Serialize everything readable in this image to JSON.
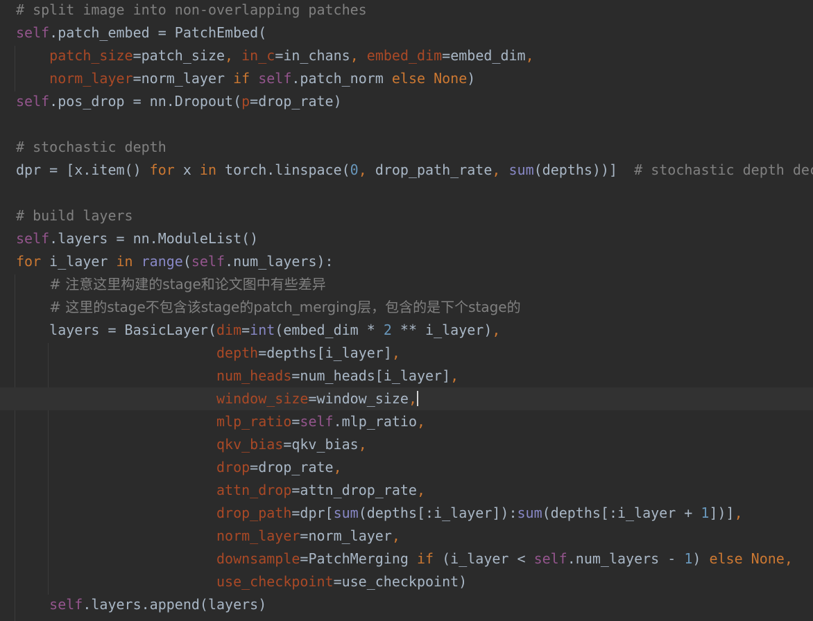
{
  "editor": {
    "theme": "dark",
    "colors": {
      "background": "#2b2b2b",
      "current_line": "#323232",
      "comment": "#808080",
      "keyword": "#cc7832",
      "self": "#94558d",
      "param": "#aa4926",
      "number": "#6897bb",
      "builtin": "#8888c6",
      "text": "#a9b7c6"
    },
    "current_line_index": 17,
    "lines": [
      {
        "indent": "",
        "tokens": [
          {
            "t": "comment",
            "v": "# split image into non-overlapping patches"
          }
        ]
      },
      {
        "indent": "",
        "tokens": [
          {
            "t": "self",
            "v": "self"
          },
          {
            "t": "plain",
            "v": ".patch_embed = PatchEmbed("
          }
        ]
      },
      {
        "indent": "    ",
        "tokens": [
          {
            "t": "param",
            "v": "patch_size"
          },
          {
            "t": "plain",
            "v": "=patch_size"
          },
          {
            "t": "keyword",
            "v": ", "
          },
          {
            "t": "param",
            "v": "in_c"
          },
          {
            "t": "plain",
            "v": "=in_chans"
          },
          {
            "t": "keyword",
            "v": ", "
          },
          {
            "t": "param",
            "v": "embed_dim"
          },
          {
            "t": "plain",
            "v": "=embed_dim"
          },
          {
            "t": "keyword",
            "v": ","
          }
        ]
      },
      {
        "indent": "    ",
        "tokens": [
          {
            "t": "param",
            "v": "norm_layer"
          },
          {
            "t": "plain",
            "v": "=norm_layer "
          },
          {
            "t": "keyword",
            "v": "if "
          },
          {
            "t": "self",
            "v": "self"
          },
          {
            "t": "plain",
            "v": ".patch_norm "
          },
          {
            "t": "keyword",
            "v": "else None"
          },
          {
            "t": "plain",
            "v": ")"
          }
        ]
      },
      {
        "indent": "",
        "tokens": [
          {
            "t": "self",
            "v": "self"
          },
          {
            "t": "plain",
            "v": ".pos_drop = nn.Dropout("
          },
          {
            "t": "param",
            "v": "p"
          },
          {
            "t": "plain",
            "v": "=drop_rate)"
          }
        ]
      },
      {
        "indent": "",
        "tokens": []
      },
      {
        "indent": "",
        "tokens": [
          {
            "t": "comment",
            "v": "# stochastic depth"
          }
        ]
      },
      {
        "indent": "",
        "tokens": [
          {
            "t": "plain",
            "v": "dpr = [x.item() "
          },
          {
            "t": "keyword",
            "v": "for "
          },
          {
            "t": "plain",
            "v": "x "
          },
          {
            "t": "keyword",
            "v": "in "
          },
          {
            "t": "plain",
            "v": "torch.linspace("
          },
          {
            "t": "number",
            "v": "0"
          },
          {
            "t": "keyword",
            "v": ", "
          },
          {
            "t": "plain",
            "v": "drop_path_rate"
          },
          {
            "t": "keyword",
            "v": ", "
          },
          {
            "t": "builtin",
            "v": "sum"
          },
          {
            "t": "plain",
            "v": "(depths))]  "
          },
          {
            "t": "comment",
            "v": "# stochastic depth dec"
          }
        ]
      },
      {
        "indent": "",
        "tokens": []
      },
      {
        "indent": "",
        "tokens": [
          {
            "t": "comment",
            "v": "# build layers"
          }
        ]
      },
      {
        "indent": "",
        "tokens": [
          {
            "t": "self",
            "v": "self"
          },
          {
            "t": "plain",
            "v": ".layers = nn.ModuleList()"
          }
        ]
      },
      {
        "indent": "",
        "tokens": [
          {
            "t": "keyword",
            "v": "for "
          },
          {
            "t": "plain",
            "v": "i_layer "
          },
          {
            "t": "keyword",
            "v": "in "
          },
          {
            "t": "builtin",
            "v": "range"
          },
          {
            "t": "plain",
            "v": "("
          },
          {
            "t": "self",
            "v": "self"
          },
          {
            "t": "plain",
            "v": ".num_layers):"
          }
        ]
      },
      {
        "indent": "    ",
        "tokens": [
          {
            "t": "comment",
            "v": "# 注意这里构建的stage和论文图中有些差异"
          }
        ]
      },
      {
        "indent": "    ",
        "tokens": [
          {
            "t": "comment",
            "v": "# 这里的stage不包含该stage的patch_merging层，包含的是下个stage的"
          }
        ]
      },
      {
        "indent": "    ",
        "tokens": [
          {
            "t": "plain",
            "v": "layers = BasicLayer("
          },
          {
            "t": "param",
            "v": "dim"
          },
          {
            "t": "plain",
            "v": "="
          },
          {
            "t": "builtin",
            "v": "int"
          },
          {
            "t": "plain",
            "v": "(embed_dim * "
          },
          {
            "t": "number",
            "v": "2"
          },
          {
            "t": "plain",
            "v": " ** i_layer)"
          },
          {
            "t": "keyword",
            "v": ","
          }
        ]
      },
      {
        "indent": "                        ",
        "tokens": [
          {
            "t": "param",
            "v": "depth"
          },
          {
            "t": "plain",
            "v": "=depths[i_layer]"
          },
          {
            "t": "keyword",
            "v": ","
          }
        ]
      },
      {
        "indent": "                        ",
        "tokens": [
          {
            "t": "param",
            "v": "num_heads"
          },
          {
            "t": "plain",
            "v": "=num_heads[i_layer]"
          },
          {
            "t": "keyword",
            "v": ","
          }
        ]
      },
      {
        "indent": "                        ",
        "tokens": [
          {
            "t": "param",
            "v": "window_size"
          },
          {
            "t": "plain",
            "v": "=window_size"
          },
          {
            "t": "keyword",
            "v": ","
          }
        ],
        "caret": true
      },
      {
        "indent": "                        ",
        "tokens": [
          {
            "t": "param",
            "v": "mlp_ratio"
          },
          {
            "t": "plain",
            "v": "="
          },
          {
            "t": "self",
            "v": "self"
          },
          {
            "t": "plain",
            "v": ".mlp_ratio"
          },
          {
            "t": "keyword",
            "v": ","
          }
        ]
      },
      {
        "indent": "                        ",
        "tokens": [
          {
            "t": "param",
            "v": "qkv_bias"
          },
          {
            "t": "plain",
            "v": "=qkv_bias"
          },
          {
            "t": "keyword",
            "v": ","
          }
        ]
      },
      {
        "indent": "                        ",
        "tokens": [
          {
            "t": "param",
            "v": "drop"
          },
          {
            "t": "plain",
            "v": "=drop_rate"
          },
          {
            "t": "keyword",
            "v": ","
          }
        ]
      },
      {
        "indent": "                        ",
        "tokens": [
          {
            "t": "param",
            "v": "attn_drop"
          },
          {
            "t": "plain",
            "v": "=attn_drop_rate"
          },
          {
            "t": "keyword",
            "v": ","
          }
        ]
      },
      {
        "indent": "                        ",
        "tokens": [
          {
            "t": "param",
            "v": "drop_path"
          },
          {
            "t": "plain",
            "v": "=dpr["
          },
          {
            "t": "builtin",
            "v": "sum"
          },
          {
            "t": "plain",
            "v": "(depths[:i_layer]):"
          },
          {
            "t": "builtin",
            "v": "sum"
          },
          {
            "t": "plain",
            "v": "(depths[:i_layer + "
          },
          {
            "t": "number",
            "v": "1"
          },
          {
            "t": "plain",
            "v": "])]"
          },
          {
            "t": "keyword",
            "v": ","
          }
        ]
      },
      {
        "indent": "                        ",
        "tokens": [
          {
            "t": "param",
            "v": "norm_layer"
          },
          {
            "t": "plain",
            "v": "=norm_layer"
          },
          {
            "t": "keyword",
            "v": ","
          }
        ]
      },
      {
        "indent": "                        ",
        "tokens": [
          {
            "t": "param",
            "v": "downsample"
          },
          {
            "t": "plain",
            "v": "=PatchMerging "
          },
          {
            "t": "keyword",
            "v": "if "
          },
          {
            "t": "plain",
            "v": "(i_layer < "
          },
          {
            "t": "self",
            "v": "self"
          },
          {
            "t": "plain",
            "v": ".num_layers - "
          },
          {
            "t": "number",
            "v": "1"
          },
          {
            "t": "plain",
            "v": ") "
          },
          {
            "t": "keyword",
            "v": "else None,"
          }
        ]
      },
      {
        "indent": "                        ",
        "tokens": [
          {
            "t": "param",
            "v": "use_checkpoint"
          },
          {
            "t": "plain",
            "v": "=use_checkpoint)"
          }
        ]
      },
      {
        "indent": "    ",
        "tokens": [
          {
            "t": "self",
            "v": "self"
          },
          {
            "t": "plain",
            "v": ".layers.append(layers)"
          }
        ]
      }
    ]
  }
}
